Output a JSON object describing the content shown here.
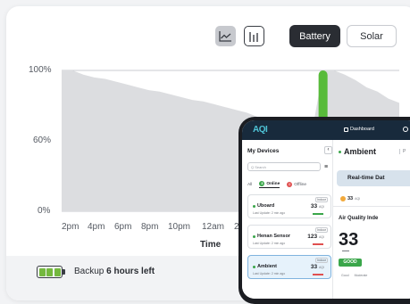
{
  "toolbar": {
    "area_icon": "area-chart-icon",
    "bars_icon": "bar-chart-icon",
    "battery_label": "Battery",
    "solar_label": "Solar"
  },
  "chart_data": {
    "type": "area",
    "y_ticks": [
      "100%",
      "60%",
      "0%"
    ],
    "ylim": [
      0,
      100
    ],
    "x_ticks": [
      "2pm",
      "4pm",
      "6pm",
      "8pm",
      "10pm",
      "12am",
      "2a"
    ],
    "xlabel": "Time",
    "series": [
      {
        "x_hours": [
          0,
          1,
          2,
          3,
          4,
          5,
          6,
          7,
          8,
          9,
          10,
          11,
          12,
          13,
          14,
          15,
          16,
          17,
          18,
          19,
          20,
          21,
          22,
          23,
          24,
          25,
          26,
          27,
          28,
          29,
          30,
          31
        ],
        "values": [
          100,
          100,
          97,
          95,
          94,
          92,
          90,
          88,
          86,
          85,
          83,
          81,
          79,
          78,
          76,
          74,
          72,
          70,
          67,
          65,
          63,
          61,
          59,
          57,
          100,
          100,
          97,
          93,
          88,
          85,
          80,
          77
        ]
      }
    ],
    "colors": {
      "area": "#dcdde0",
      "highlight": "#58bb3a",
      "axis": "#c8cbd0"
    }
  },
  "footer": {
    "icon": "battery-icon",
    "prefix": "Backup",
    "highlight": "6 hours left"
  },
  "phone": {
    "logo": "AQI",
    "nav": {
      "dashboard": "Dashboard",
      "settings_icon": "settings-icon"
    },
    "devices": {
      "title": "My Devices",
      "search_placeholder": "Q Search",
      "tabs": {
        "all": "All",
        "online_count": "3",
        "online": "Online",
        "offline_count": "0",
        "offline": "Offline"
      },
      "items": [
        {
          "tag": "Indoor",
          "name": "Uboard",
          "updated": "Last Update: 2 min ago",
          "aqi": "33",
          "unit": "AQI",
          "line_color": "#3aa64a"
        },
        {
          "tag": "Indoor",
          "name": "Henan Sensor",
          "updated": "Last Update: 2 min ago",
          "aqi": "123",
          "unit": "AQI",
          "line_color": "#e05050"
        },
        {
          "tag": "Indoor",
          "name": "Ambient",
          "updated": "Last Update: 2 min ago",
          "aqi": "33",
          "unit": "AQI",
          "line_color": "#e05050"
        }
      ]
    },
    "detail": {
      "title": "Ambient",
      "tag": "P",
      "realtime": "Real-time Dat",
      "aqi_value": "33",
      "aqi_unit": "AQI",
      "aq_title": "Air Quality Inde",
      "aq_number": "33",
      "badge": "GOOD",
      "scale": [
        "Good",
        "Moderate"
      ]
    }
  }
}
